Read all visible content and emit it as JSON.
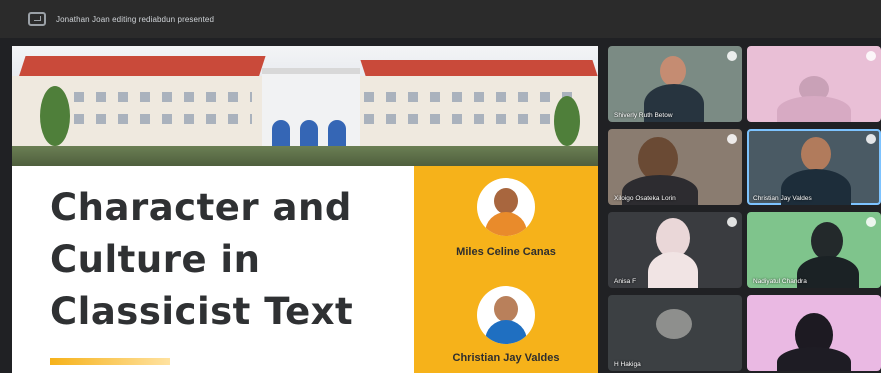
{
  "topbar": {
    "presenting_text": "Jonathan Joan editing rediabdun presented"
  },
  "slide": {
    "title_lines": [
      "Character and",
      "Culture in",
      "Classicist Text"
    ],
    "presenters": [
      {
        "name": "Miles Celine Canas"
      },
      {
        "name": "Christian Jay Valdes"
      }
    ]
  },
  "gallery": {
    "participants": [
      {
        "name": "Shiverly Ruth Betow"
      },
      {
        "name": ""
      },
      {
        "name": "Xiloigo Osateka Lorin"
      },
      {
        "name": "Christian Jay Valdes"
      },
      {
        "name": "Anisa F"
      },
      {
        "name": "Nadiyatul Chandra"
      },
      {
        "name": "H Hakiga"
      },
      {
        "name": ""
      }
    ]
  }
}
